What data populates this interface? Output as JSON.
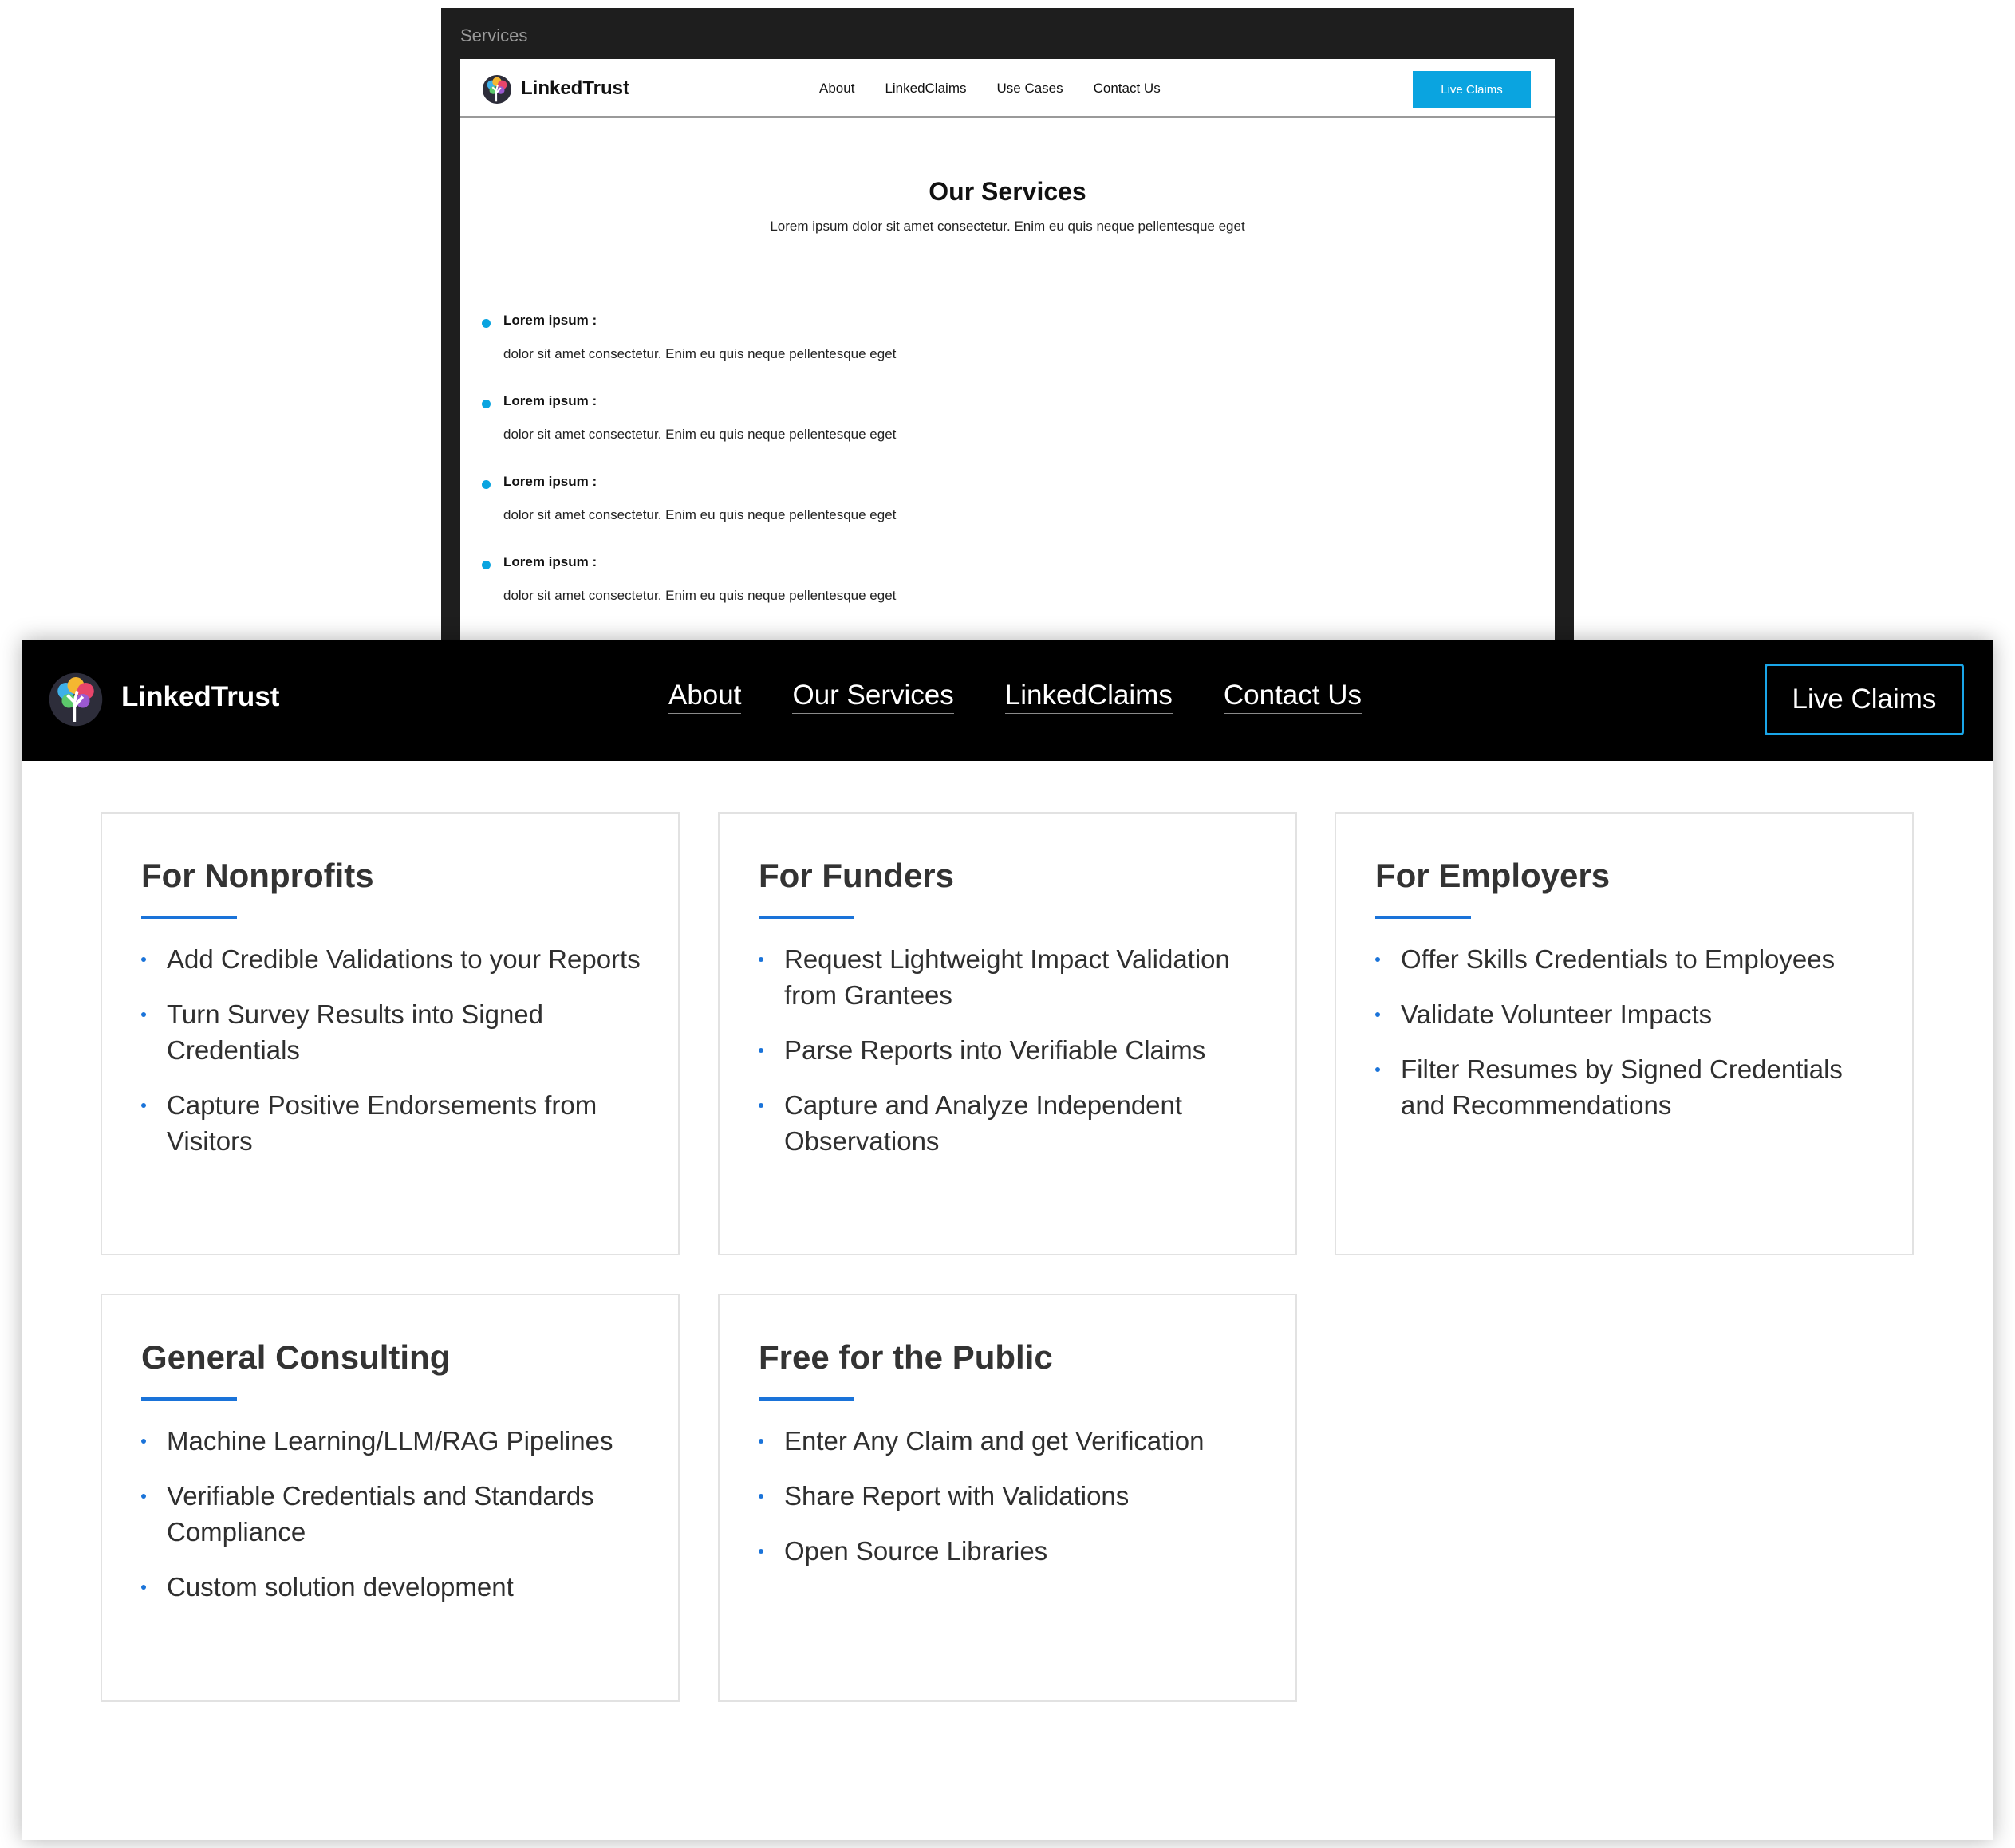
{
  "mockup": {
    "label": "Services",
    "brand": "LinkedTrust",
    "nav": [
      "About",
      "LinkedClaims",
      "Use Cases",
      "Contact Us"
    ],
    "cta": "Live Claims",
    "heading": "Our Services",
    "subheading": "Lorem ipsum dolor sit amet consectetur. Enim eu quis neque pellentesque eget",
    "items": [
      {
        "title": "Lorem ipsum :",
        "text": "dolor sit amet consectetur. Enim eu quis neque pellentesque eget"
      },
      {
        "title": "Lorem ipsum :",
        "text": "dolor sit amet consectetur. Enim eu quis neque pellentesque eget"
      },
      {
        "title": "Lorem ipsum :",
        "text": "dolor sit amet consectetur. Enim eu quis neque pellentesque eget"
      },
      {
        "title": "Lorem ipsum :",
        "text": "dolor sit amet consectetur. Enim eu quis neque pellentesque eget"
      }
    ],
    "accent_color": "#0aa4e0"
  },
  "page": {
    "brand": "LinkedTrust",
    "nav": [
      "About",
      "Our Services",
      "LinkedClaims",
      "Contact Us"
    ],
    "cta": "Live Claims",
    "accent_color": "#1a73d9",
    "cta_border_color": "#1aa6e8",
    "cards": [
      {
        "title": "For Nonprofits",
        "items": [
          "Add Credible Validations to your Reports",
          "Turn Survey Results into Signed Credentials",
          "Capture Positive Endorsements from Visitors"
        ]
      },
      {
        "title": "For Funders",
        "items": [
          "Request Lightweight Impact Validation from Grantees",
          "Parse Reports into Verifiable Claims",
          "Capture and Analyze Independent Observations"
        ]
      },
      {
        "title": "For Employers",
        "items": [
          "Offer Skills Credentials to Employees",
          "Validate Volunteer Impacts",
          "Filter Resumes by Signed Credentials and Recommendations"
        ]
      },
      {
        "title": "General Consulting",
        "items": [
          "Machine Learning/LLM/RAG Pipelines",
          "Verifiable Credentials and Standards Compliance",
          "Custom solution development"
        ]
      },
      {
        "title": "Free for the Public",
        "items": [
          "Enter Any Claim and get Verification",
          "Share Report with Validations",
          "Open Source Libraries"
        ]
      }
    ]
  }
}
